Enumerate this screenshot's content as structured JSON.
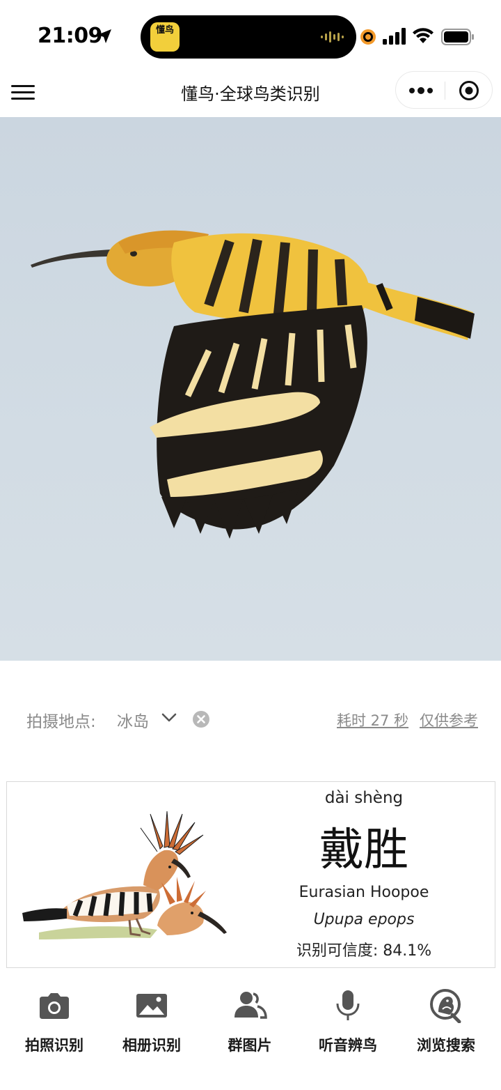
{
  "status_bar": {
    "time": "21:09"
  },
  "island": {
    "app_badge": "懂鸟"
  },
  "navbar": {
    "title": "懂鸟·全球鸟类识别"
  },
  "location": {
    "label": "拍摄地点:",
    "value": "冰岛",
    "elapsed": "耗时 27 秒",
    "reference": "仅供参考"
  },
  "result": {
    "pinyin": "dài shèng",
    "chinese_name": "戴胜",
    "english_name": "Eurasian Hoopoe",
    "scientific_name": "Upupa epops",
    "confidence": "识别可信度: 84.1%"
  },
  "tabs": [
    {
      "label": "拍照识别",
      "icon": "camera-icon"
    },
    {
      "label": "相册识别",
      "icon": "image-icon"
    },
    {
      "label": "群图片",
      "icon": "group-icon"
    },
    {
      "label": "听音辨鸟",
      "icon": "microphone-icon"
    },
    {
      "label": "浏览搜索",
      "icon": "bird-search-icon"
    }
  ]
}
